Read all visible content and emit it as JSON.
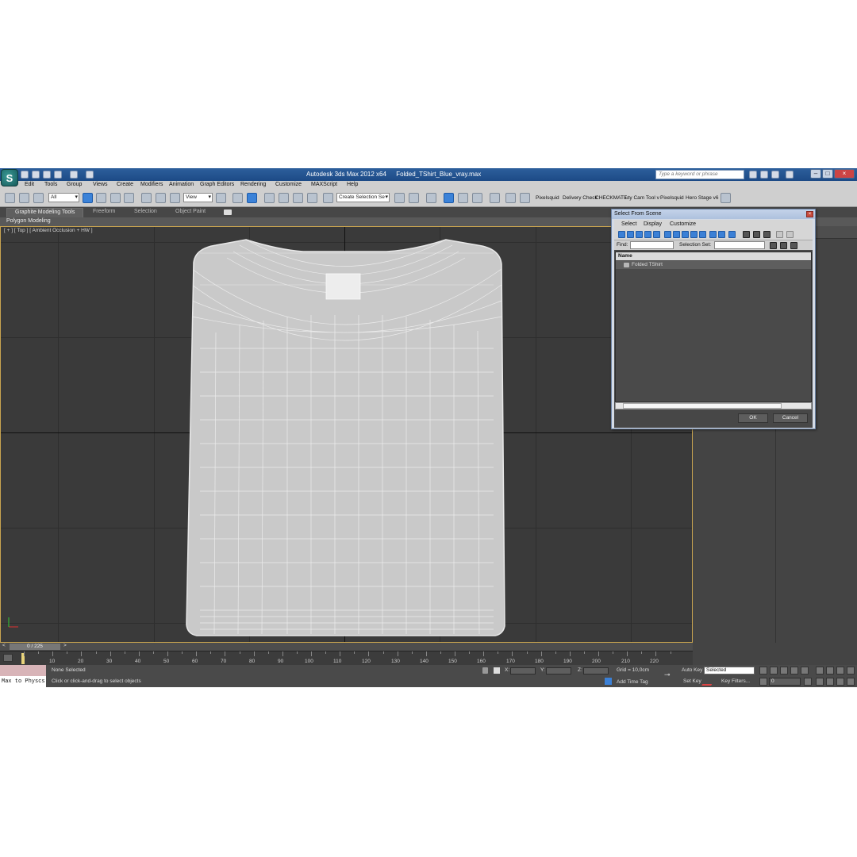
{
  "titlebar": {
    "app_name": "Autodesk 3ds Max  2012 x64",
    "file_name": "Folded_TShirt_Blue_vray.max",
    "search_placeholder": "Type a keyword or phrase"
  },
  "menu": [
    "Edit",
    "Tools",
    "Group",
    "Views",
    "Create",
    "Modifiers",
    "Animation",
    "Graph Editors",
    "Rendering",
    "Customize",
    "MAXScript",
    "Help"
  ],
  "toolbar": {
    "selection_filter": "All",
    "ref_coord": "View",
    "named_selection": "Create Selection Se",
    "plugins": [
      "Pixelsquid",
      "Delivery Check",
      "CHECKMATE",
      "uty Cam Tool v",
      "Pixelsquid",
      "Hero Stage v6"
    ]
  },
  "ribbon": {
    "tabs": [
      "Graphite Modeling Tools",
      "Freeform",
      "Selection",
      "Object Paint"
    ],
    "panel": "Polygon Modeling"
  },
  "viewport": {
    "label": "[ + ] [ Top ] [ Ambient Occlusion + HW ]"
  },
  "dialog": {
    "title": "Select From Scene",
    "menu": [
      "Select",
      "Display",
      "Customize"
    ],
    "find_label": "Find:",
    "selection_set_label": "Selection Set:",
    "column_header": "Name",
    "items": [
      "Folded TShirt"
    ],
    "ok": "OK",
    "cancel": "Cancel"
  },
  "timeline": {
    "frame_counter": "0 / 225",
    "ticks": [
      "10",
      "20",
      "30",
      "40",
      "50",
      "60",
      "70",
      "80",
      "90",
      "100",
      "110",
      "120",
      "130",
      "140",
      "150",
      "160",
      "170",
      "180",
      "190",
      "200",
      "210",
      "220"
    ]
  },
  "status": {
    "maxscript": "Max to Physcs",
    "selection": "None Selected",
    "prompt": "Click or click-and-drag to select objects",
    "x_label": "X:",
    "y_label": "Y:",
    "z_label": "Z:",
    "grid": "Grid = 10,0cm",
    "add_time_tag": "Add Time Tag",
    "auto_key": "Auto Key",
    "set_key": "Set Key",
    "key_mode": "Selected",
    "key_filters": "Key Filters...",
    "current_frame": "0"
  },
  "colors": {
    "viewport_border": "#c8a450",
    "titlebar": "#1c4a86",
    "ui_gray": "#444444"
  }
}
